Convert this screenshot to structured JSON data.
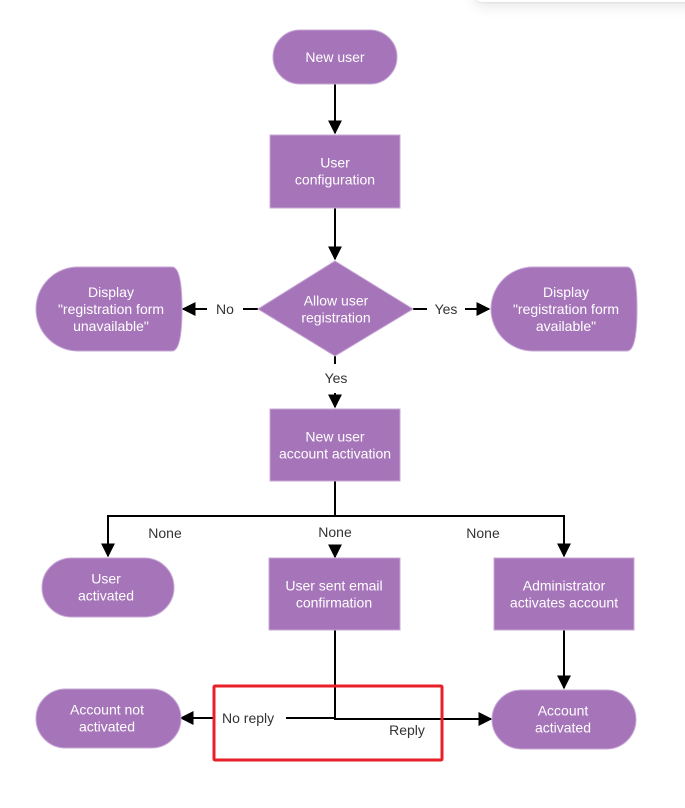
{
  "diagram": {
    "type": "flowchart",
    "colors": {
      "node_fill": "#a674b9",
      "node_text": "#ffffff",
      "edge": "#000000",
      "label_text": "#333333",
      "highlight": "#e8202a"
    },
    "nodes": {
      "new_user": {
        "lines": [
          "New user"
        ],
        "shape": "terminal"
      },
      "user_configuration": {
        "lines": [
          "User",
          "configuration"
        ],
        "shape": "process"
      },
      "allow_registration": {
        "lines": [
          "Allow user",
          "registration"
        ],
        "shape": "decision"
      },
      "form_unavailable": {
        "lines": [
          "Display",
          "\"registration form",
          "unavailable\""
        ],
        "shape": "display"
      },
      "form_available": {
        "lines": [
          "Display",
          "\"registration form",
          "available\""
        ],
        "shape": "display"
      },
      "account_activation": {
        "lines": [
          "New user",
          "account activation"
        ],
        "shape": "process"
      },
      "user_activated": {
        "lines": [
          "User",
          "activated"
        ],
        "shape": "terminal"
      },
      "email_confirmation": {
        "lines": [
          "User sent email",
          "confirmation"
        ],
        "shape": "process"
      },
      "admin_activates": {
        "lines": [
          "Administrator",
          "activates account"
        ],
        "shape": "process"
      },
      "account_not_activated": {
        "lines": [
          "Account not",
          "activated"
        ],
        "shape": "terminal"
      },
      "account_activated": {
        "lines": [
          "Account",
          "activated"
        ],
        "shape": "terminal"
      }
    },
    "edge_labels": {
      "no": "No",
      "yes_right": "Yes",
      "yes_down": "Yes",
      "none_left": "None",
      "none_middle": "None",
      "none_right": "None",
      "no_reply": "No reply",
      "reply": "Reply"
    }
  }
}
